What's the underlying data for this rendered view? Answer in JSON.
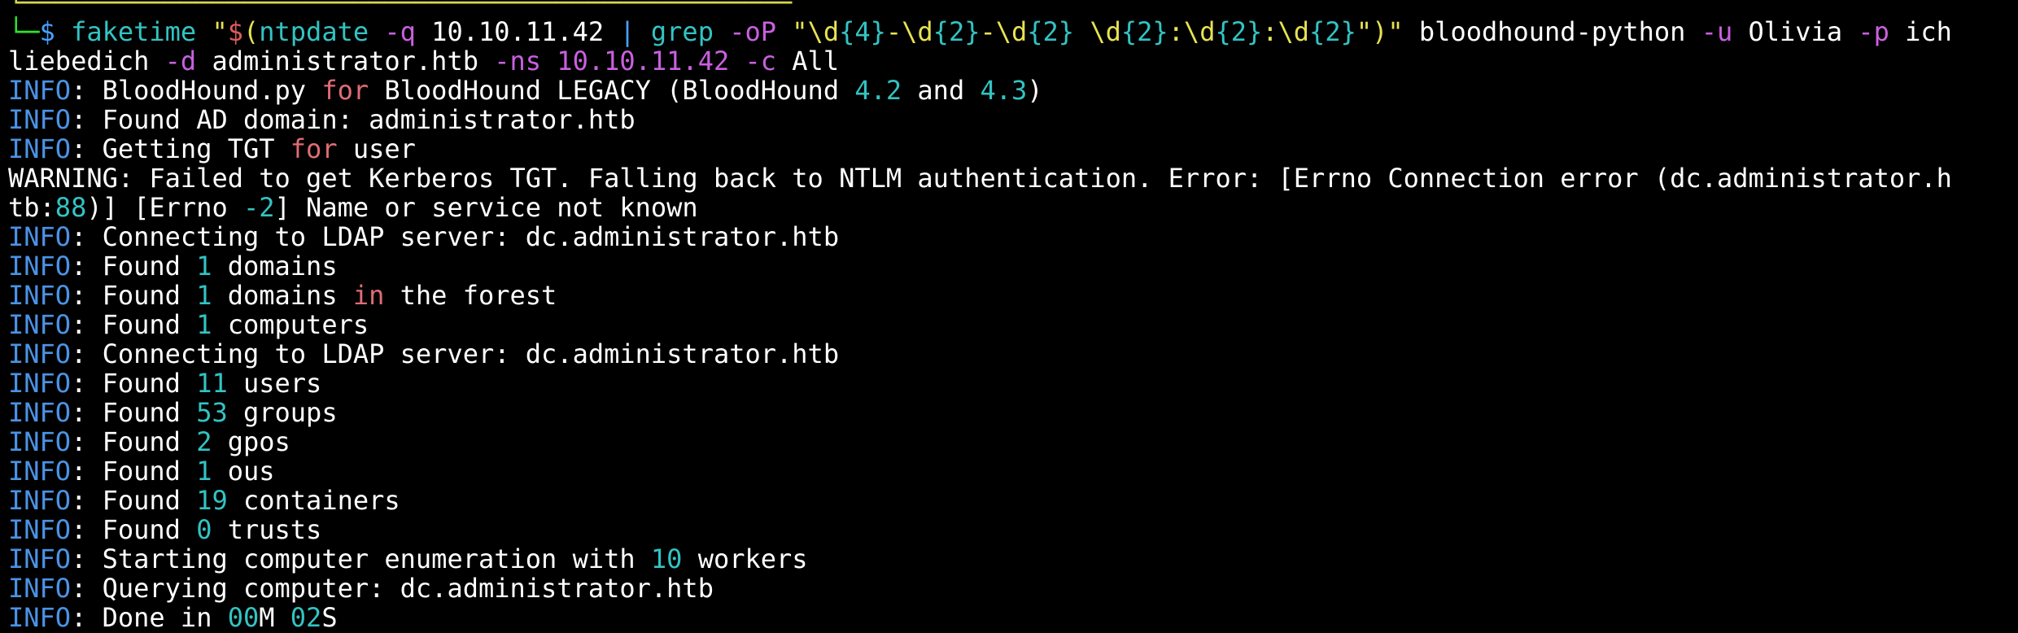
{
  "terminal": {
    "lines": [
      {
        "kind": "partial-top",
        "segs": [
          {
            "t": "└─────────────────────────────────────────────────",
            "c": "ghost"
          }
        ]
      },
      {
        "kind": "command",
        "segs": [
          {
            "t": "└─",
            "c": "g"
          },
          {
            "t": "$",
            "c": "b"
          },
          {
            "t": " faketime ",
            "c": "c"
          },
          {
            "t": "\"",
            "c": "y"
          },
          {
            "t": "$",
            "c": "k"
          },
          {
            "t": "(",
            "c": "y"
          },
          {
            "t": "ntpdate ",
            "c": "c"
          },
          {
            "t": "-q",
            "c": "p"
          },
          {
            "t": " 10.10.11.42 ",
            "c": "w"
          },
          {
            "t": "|",
            "c": "b"
          },
          {
            "t": " grep ",
            "c": "c"
          },
          {
            "t": "-oP",
            "c": "p"
          },
          {
            "t": " \"\\d",
            "c": "y"
          },
          {
            "t": "{4}",
            "c": "c"
          },
          {
            "t": "-\\d",
            "c": "y"
          },
          {
            "t": "{2}",
            "c": "c"
          },
          {
            "t": "-\\d",
            "c": "y"
          },
          {
            "t": "{2}",
            "c": "c"
          },
          {
            "t": " \\d",
            "c": "y"
          },
          {
            "t": "{2}",
            "c": "c"
          },
          {
            "t": ":\\d",
            "c": "y"
          },
          {
            "t": "{2}",
            "c": "c"
          },
          {
            "t": ":\\d",
            "c": "y"
          },
          {
            "t": "{2}",
            "c": "c"
          },
          {
            "t": "\")\"",
            "c": "y"
          },
          {
            "t": " bloodhound-python ",
            "c": "w"
          },
          {
            "t": "-u",
            "c": "p"
          },
          {
            "t": " Olivia ",
            "c": "w"
          },
          {
            "t": "-p",
            "c": "p"
          },
          {
            "t": " ich",
            "c": "w"
          }
        ]
      },
      {
        "kind": "command-wrap",
        "segs": [
          {
            "t": "liebedich ",
            "c": "w"
          },
          {
            "t": "-d",
            "c": "p"
          },
          {
            "t": " administrator.htb ",
            "c": "w"
          },
          {
            "t": "-ns",
            "c": "p"
          },
          {
            "t": " 10.10.11.42 ",
            "c": "p"
          },
          {
            "t": "-c",
            "c": "p"
          },
          {
            "t": " All",
            "c": "w"
          }
        ]
      },
      {
        "kind": "log",
        "segs": [
          {
            "t": "INFO",
            "c": "info"
          },
          {
            "t": ": BloodHound.py ",
            "c": "w"
          },
          {
            "t": "for",
            "c": "r"
          },
          {
            "t": " BloodHound LEGACY (BloodHound ",
            "c": "w"
          },
          {
            "t": "4.2",
            "c": "c"
          },
          {
            "t": " and ",
            "c": "w"
          },
          {
            "t": "4.3",
            "c": "c"
          },
          {
            "t": ")",
            "c": "w"
          }
        ]
      },
      {
        "kind": "log",
        "segs": [
          {
            "t": "INFO",
            "c": "info"
          },
          {
            "t": ": Found AD domain: administrator.htb",
            "c": "w"
          }
        ]
      },
      {
        "kind": "log",
        "segs": [
          {
            "t": "INFO",
            "c": "info"
          },
          {
            "t": ": Getting TGT ",
            "c": "w"
          },
          {
            "t": "for",
            "c": "r"
          },
          {
            "t": " user",
            "c": "w"
          }
        ]
      },
      {
        "kind": "log",
        "segs": [
          {
            "t": "WARNING: Failed to get Kerberos TGT. Falling back to NTLM authentication. Error: [Errno Connection error (dc.administrator.h",
            "c": "w"
          }
        ]
      },
      {
        "kind": "log-wrap",
        "segs": [
          {
            "t": "tb:",
            "c": "w"
          },
          {
            "t": "88",
            "c": "c"
          },
          {
            "t": ")] [Errno ",
            "c": "w"
          },
          {
            "t": "-2",
            "c": "c"
          },
          {
            "t": "] Name or service not known",
            "c": "w"
          }
        ]
      },
      {
        "kind": "log",
        "segs": [
          {
            "t": "INFO",
            "c": "info"
          },
          {
            "t": ": Connecting to LDAP server: dc.administrator.htb",
            "c": "w"
          }
        ]
      },
      {
        "kind": "log",
        "segs": [
          {
            "t": "INFO",
            "c": "info"
          },
          {
            "t": ": Found ",
            "c": "w"
          },
          {
            "t": "1",
            "c": "c"
          },
          {
            "t": " domains",
            "c": "w"
          }
        ]
      },
      {
        "kind": "log",
        "segs": [
          {
            "t": "INFO",
            "c": "info"
          },
          {
            "t": ": Found ",
            "c": "w"
          },
          {
            "t": "1",
            "c": "c"
          },
          {
            "t": " domains ",
            "c": "w"
          },
          {
            "t": "in",
            "c": "r"
          },
          {
            "t": " the forest",
            "c": "w"
          }
        ]
      },
      {
        "kind": "log",
        "segs": [
          {
            "t": "INFO",
            "c": "info"
          },
          {
            "t": ": Found ",
            "c": "w"
          },
          {
            "t": "1",
            "c": "c"
          },
          {
            "t": " computers",
            "c": "w"
          }
        ]
      },
      {
        "kind": "log",
        "segs": [
          {
            "t": "INFO",
            "c": "info"
          },
          {
            "t": ": Connecting to LDAP server: dc.administrator.htb",
            "c": "w"
          }
        ]
      },
      {
        "kind": "log",
        "segs": [
          {
            "t": "INFO",
            "c": "info"
          },
          {
            "t": ": Found ",
            "c": "w"
          },
          {
            "t": "11",
            "c": "c"
          },
          {
            "t": " users",
            "c": "w"
          }
        ]
      },
      {
        "kind": "log",
        "segs": [
          {
            "t": "INFO",
            "c": "info"
          },
          {
            "t": ": Found ",
            "c": "w"
          },
          {
            "t": "53",
            "c": "c"
          },
          {
            "t": " groups",
            "c": "w"
          }
        ]
      },
      {
        "kind": "log",
        "segs": [
          {
            "t": "INFO",
            "c": "info"
          },
          {
            "t": ": Found ",
            "c": "w"
          },
          {
            "t": "2",
            "c": "c"
          },
          {
            "t": " gpos",
            "c": "w"
          }
        ]
      },
      {
        "kind": "log",
        "segs": [
          {
            "t": "INFO",
            "c": "info"
          },
          {
            "t": ": Found ",
            "c": "w"
          },
          {
            "t": "1",
            "c": "c"
          },
          {
            "t": " ous",
            "c": "w"
          }
        ]
      },
      {
        "kind": "log",
        "segs": [
          {
            "t": "INFO",
            "c": "info"
          },
          {
            "t": ": Found ",
            "c": "w"
          },
          {
            "t": "19",
            "c": "c"
          },
          {
            "t": " containers",
            "c": "w"
          }
        ]
      },
      {
        "kind": "log",
        "segs": [
          {
            "t": "INFO",
            "c": "info"
          },
          {
            "t": ": Found ",
            "c": "w"
          },
          {
            "t": "0",
            "c": "c"
          },
          {
            "t": " trusts",
            "c": "w"
          }
        ]
      },
      {
        "kind": "log",
        "segs": [
          {
            "t": "INFO",
            "c": "info"
          },
          {
            "t": ": Starting computer enumeration with ",
            "c": "w"
          },
          {
            "t": "10",
            "c": "c"
          },
          {
            "t": " workers",
            "c": "w"
          }
        ]
      },
      {
        "kind": "log",
        "segs": [
          {
            "t": "INFO",
            "c": "info"
          },
          {
            "t": ": Querying computer: dc.administrator.htb",
            "c": "w"
          }
        ]
      },
      {
        "kind": "partial-bottom",
        "segs": [
          {
            "t": "INFO",
            "c": "info"
          },
          {
            "t": ": Done in ",
            "c": "w"
          },
          {
            "t": "00",
            "c": "c"
          },
          {
            "t": "M ",
            "c": "w"
          },
          {
            "t": "02",
            "c": "c"
          },
          {
            "t": "S",
            "c": "w"
          }
        ]
      }
    ]
  }
}
